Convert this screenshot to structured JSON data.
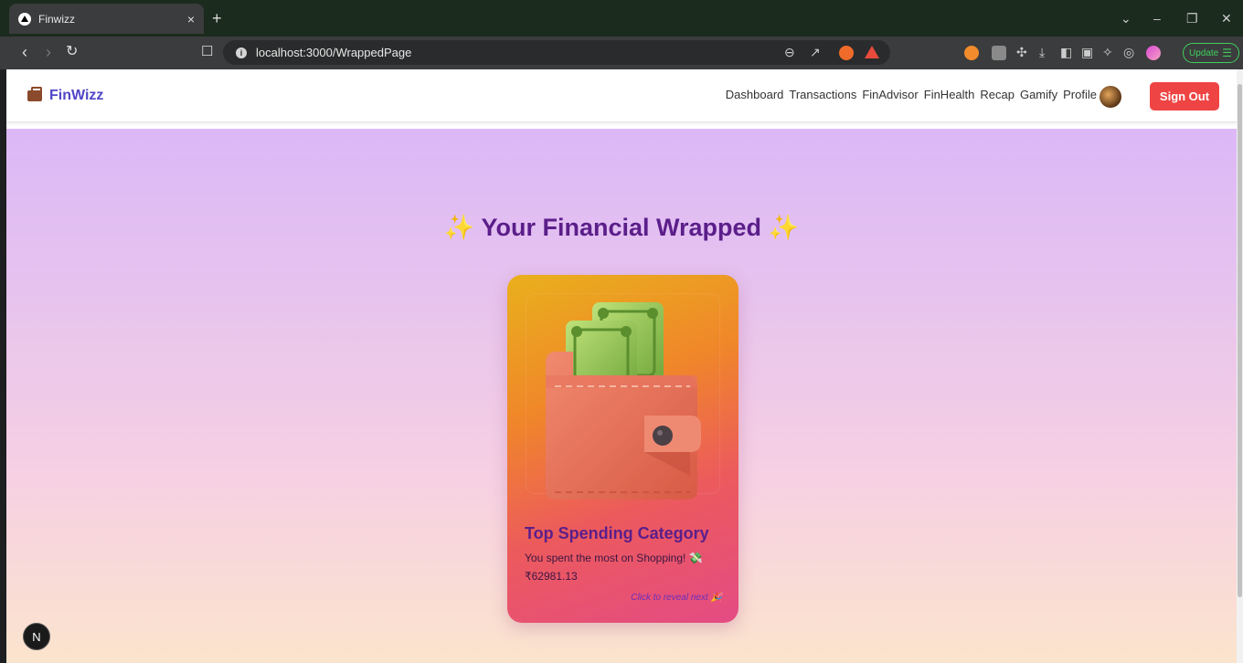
{
  "browser": {
    "tab_title": "Finwizz",
    "tab_close": "×",
    "new_tab": "+",
    "url": "localhost:3000/WrappedPage",
    "update_label": "Update"
  },
  "app": {
    "brand": "FinWizz",
    "nav": [
      "Dashboard",
      "Transactions",
      "FinAdvisor",
      "FinHealth",
      "Recap",
      "Gamify",
      "Profile"
    ],
    "sign_out": "Sign Out"
  },
  "wrapped": {
    "heading": "Your Financial Wrapped",
    "sparkle": "✨",
    "card": {
      "title": "Top Spending Category",
      "description": "You spent the most on Shopping! 💸",
      "amount": "₹62981.13",
      "hint": "Click to reveal next 🎉"
    }
  },
  "dev_badge": "N",
  "colors": {
    "brand": "#4f46c8",
    "heading": "#5b1e8a",
    "sign_out": "#ef4444",
    "hint": "#6b2fb8"
  }
}
